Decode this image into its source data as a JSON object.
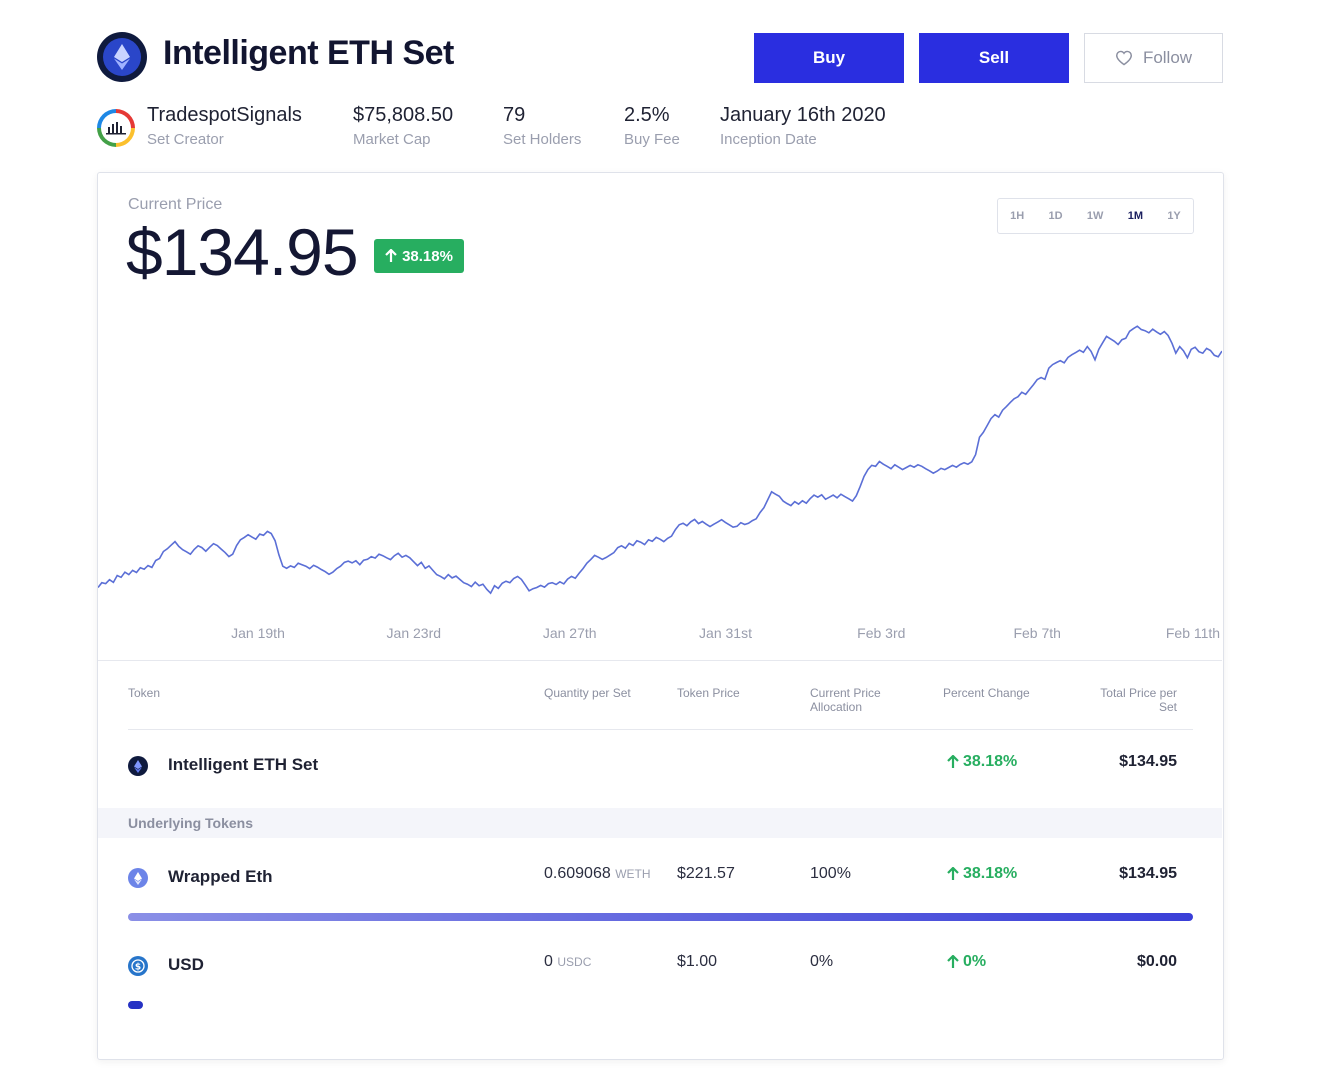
{
  "header": {
    "title": "Intelligent ETH Set",
    "buy_label": "Buy",
    "sell_label": "Sell",
    "follow_label": "Follow"
  },
  "stats": {
    "creator_name": "TradespotSignals",
    "creator_label": "Set Creator",
    "market_cap": "$75,808.50",
    "market_cap_label": "Market Cap",
    "holders": "79",
    "holders_label": "Set Holders",
    "buy_fee": "2.5%",
    "buy_fee_label": "Buy Fee",
    "inception": "January 16th 2020",
    "inception_label": "Inception Date"
  },
  "price": {
    "label": "Current Price",
    "value": "$134.95",
    "change": "38.18%"
  },
  "ranges": [
    "1H",
    "1D",
    "1W",
    "1M",
    "1Y"
  ],
  "active_range": "1M",
  "colors": {
    "accent": "#2a2ee0",
    "positive": "#27ae60",
    "line": "#5b6fd6"
  },
  "chart_data": {
    "type": "line",
    "x_ticks": [
      "Jan 19th",
      "Jan 23rd",
      "Jan 27th",
      "Jan 31st",
      "Feb 3rd",
      "Feb 7th",
      "Feb 11th"
    ],
    "series": [
      {
        "values": [
          97.5,
          99.1,
          98.8,
          100.1,
          99.2,
          101.5,
          100.9,
          102.6,
          101.8,
          103.2,
          102.5,
          104.1,
          103.6,
          104.8,
          104.2,
          106.5,
          107.2,
          109.5,
          110.4,
          111.6,
          112.8,
          111.2,
          110.1,
          109.4,
          108.6,
          110.2,
          111.4,
          110.8,
          109.6,
          110.9,
          112.1,
          111.5,
          110.3,
          109.2,
          107.8,
          108.6,
          111.5,
          113.4,
          114.2,
          115.1,
          114.3,
          113.6,
          115.3,
          114.9,
          116.2,
          115.5,
          113.1,
          108.4,
          104.6,
          103.9,
          104.7,
          104.2,
          105.6,
          105.1,
          104.6,
          103.8,
          104.9,
          104.3,
          103.5,
          102.8,
          101.9,
          102.6,
          103.8,
          104.6,
          105.9,
          106.3,
          105.7,
          106.4,
          105.1,
          106.6,
          106.9,
          107.8,
          107.3,
          108.6,
          108.1,
          107.4,
          106.8,
          108.1,
          108.9,
          107.6,
          108.2,
          107.4,
          106.1,
          104.8,
          105.9,
          103.9,
          104.7,
          103.2,
          101.8,
          101.2,
          100.4,
          101.8,
          100.7,
          101.3,
          100.2,
          99.1,
          98.6,
          97.8,
          99.3,
          98.1,
          98.6,
          96.9,
          95.6,
          98.1,
          97.2,
          98.9,
          99.6,
          99.1,
          100.5,
          101.2,
          100.2,
          98.3,
          96.4,
          97.1,
          97.5,
          98.2,
          97.6,
          98.8,
          99.1,
          98.5,
          99.4,
          98.7,
          100.3,
          101.2,
          100.6,
          102.3,
          103.8,
          105.6,
          106.8,
          108.2,
          107.6,
          106.9,
          107.5,
          108.3,
          109.1,
          110.8,
          111.4,
          110.6,
          112.2,
          111.5,
          113.1,
          112.6,
          111.8,
          113.4,
          112.9,
          114.2,
          113.6,
          112.8,
          113.9,
          114.6,
          116.8,
          118.4,
          118.9,
          118.1,
          119.4,
          120.2,
          118.8,
          119.5,
          118.6,
          117.8,
          118.6,
          119.3,
          120.1,
          119.2,
          118.4,
          117.6,
          117.9,
          119.1,
          118.5,
          118.9,
          119.8,
          120.4,
          122.5,
          124.1,
          126.8,
          129.4,
          128.6,
          127.9,
          126.3,
          125.5,
          124.8,
          126.1,
          125.3,
          126.4,
          125.6,
          127.1,
          128.3,
          127.6,
          128.4,
          126.9,
          127.6,
          128.3,
          127.4,
          128.6,
          127.8,
          127.1,
          126.3,
          128.1,
          131.2,
          134.5,
          136.8,
          138.2,
          137.9,
          139.5,
          138.6,
          137.9,
          137.1,
          138.4,
          137.6,
          136.8,
          137.5,
          138.2,
          137.6,
          138.4,
          137.9,
          137.1,
          136.4,
          135.6,
          136.3,
          137.2,
          136.8,
          137.5,
          138.2,
          137.6,
          138.5,
          139.1,
          138.6,
          139.4,
          141.8,
          147.6,
          149.2,
          151.5,
          153.8,
          155.1,
          154.3,
          156.6,
          157.8,
          159.2,
          160.4,
          161.1,
          162.6,
          161.9,
          163.5,
          165.1,
          166.8,
          167.5,
          166.9,
          170.6,
          171.8,
          172.5,
          173.1,
          172.4,
          174.2,
          175.1,
          175.8,
          176.6,
          175.9,
          177.8,
          176.2,
          173.4,
          176.9,
          179.1,
          181.2,
          180.4,
          179.6,
          178.5,
          180.1,
          180.6,
          182.9,
          183.8,
          184.6,
          183.5,
          183.1,
          182.4,
          183.6,
          182.7,
          181.9,
          182.8,
          181.5,
          178.9,
          175.6,
          177.8,
          176.4,
          174.1,
          176.9,
          177.6,
          176.1,
          175.6,
          177.2,
          176.5,
          174.9,
          174.4,
          176.3
        ]
      }
    ],
    "ylim": [
      90,
      190
    ]
  },
  "table": {
    "headers": {
      "token": "Token",
      "quantity": "Quantity per Set",
      "token_price": "Token Price",
      "allocation_1": "Current Price",
      "allocation_2": "Allocation",
      "percent": "Percent Change",
      "total_1": "Total Price per",
      "total_2": "Set"
    },
    "set_row": {
      "name": "Intelligent ETH Set",
      "percent": "38.18%",
      "total": "$134.95"
    },
    "underlying_label": "Underlying Tokens",
    "rows": [
      {
        "name": "Wrapped Eth",
        "quantity": "0.609068",
        "unit": "WETH",
        "token_price": "$221.57",
        "allocation": "100%",
        "percent": "38.18%",
        "total": "$134.95",
        "allocation_fraction": 1.0
      },
      {
        "name": "USD",
        "quantity": "0",
        "unit": "USDC",
        "token_price": "$1.00",
        "allocation": "0%",
        "percent": "0%",
        "total": "$0.00",
        "allocation_fraction": 0.0
      }
    ]
  }
}
